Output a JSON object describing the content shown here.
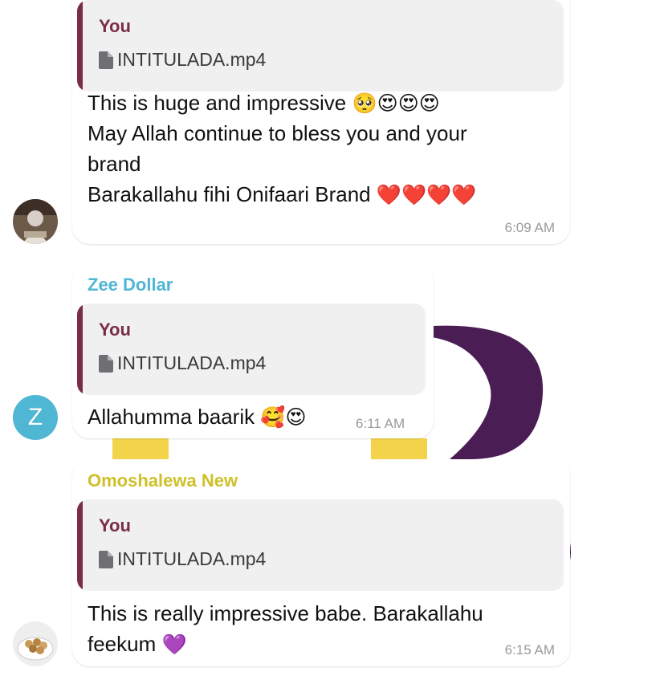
{
  "messages": [
    {
      "sender": "",
      "reply": {
        "author": "You",
        "file": "INTITULADA.mp4"
      },
      "lines": [
        "This is huge and impressive",
        "May Allah continue to bless you and your",
        "brand",
        "Barakallahu fihi Onifaari Brand"
      ],
      "emoji_line1": "🥺😍😍😍",
      "emoji_line4": "❤️❤️❤️❤️",
      "time": "6:09 AM"
    },
    {
      "sender": "Zee Dollar",
      "sender_color": "#4fb6d3",
      "avatar_letter": "Z",
      "reply": {
        "author": "You",
        "file": "INTITULADA.mp4"
      },
      "lines": [
        "Allahumma baarik"
      ],
      "emoji_line1": "🥰😍",
      "time": "6:11 AM"
    },
    {
      "sender": "Omoshalewa New",
      "sender_color": "#cfc02a",
      "reply": {
        "author": "You",
        "file": "INTITULADA.mp4"
      },
      "lines": [
        "This is really impressive babe. Barakallahu",
        "feekum"
      ],
      "emoji_line2": "💜",
      "time": "6:15 AM"
    }
  ],
  "colors": {
    "reply_bar": "#7a2d4a",
    "wallpaper_purple": "#4b1d55",
    "wallpaper_yellow": "#f2d34a"
  }
}
